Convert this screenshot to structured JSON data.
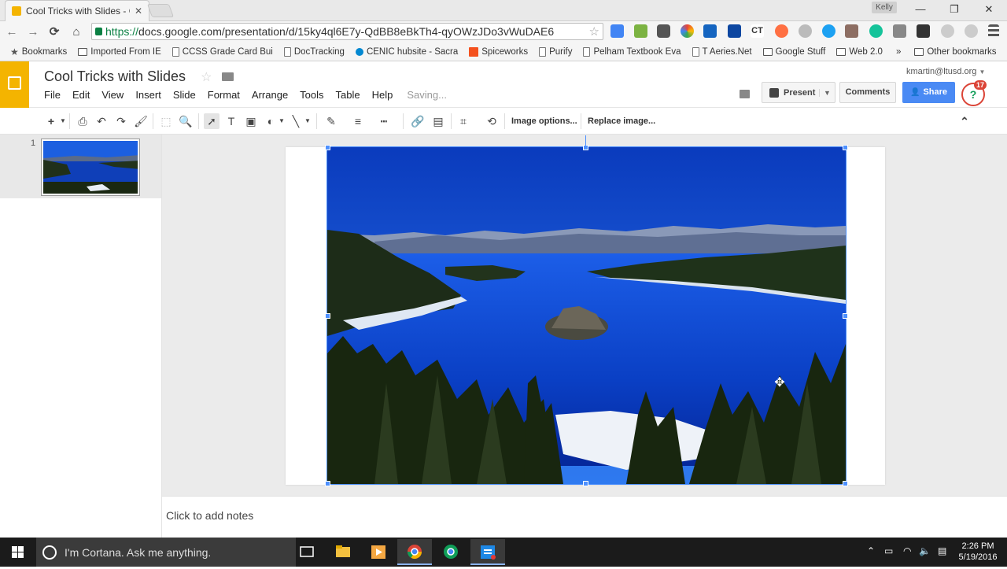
{
  "browser": {
    "tab_title": "Cool Tricks with Slides - G",
    "tab_close": "✕",
    "user_badge": "Kelly",
    "win_minimize": "—",
    "win_restore": "❐",
    "win_close": "✕",
    "url_scheme": "https://",
    "url_rest": "docs.google.com/presentation/d/15ky4ql6E7y-QdBB8eBkTh4-qyOWzJDo3vWuDAE6",
    "back_icon": "←",
    "forward_icon": "→",
    "reload_icon": "⟳",
    "home_icon": "⌂",
    "star_icon": "☆"
  },
  "bookmarks": {
    "items": [
      {
        "label": "Bookmarks",
        "icon": "star-icon"
      },
      {
        "label": "Imported From IE",
        "icon": "folder-icon"
      },
      {
        "label": "CCSS Grade Card Bui",
        "icon": "page-icon"
      },
      {
        "label": "DocTracking",
        "icon": "page-icon"
      },
      {
        "label": "CENIC hubsite - Sacra",
        "icon": "cenic-icon"
      },
      {
        "label": "Spiceworks",
        "icon": "spiceworks-icon"
      },
      {
        "label": "Purify",
        "icon": "page-icon"
      },
      {
        "label": "Pelham Textbook Eva",
        "icon": "page-icon"
      },
      {
        "label": "T Aeries.Net",
        "icon": "page-icon"
      },
      {
        "label": "Google Stuff",
        "icon": "folder-icon"
      },
      {
        "label": "Web 2.0",
        "icon": "folder-icon"
      }
    ],
    "overflow": "»",
    "other_label": "Other bookmarks"
  },
  "docs": {
    "title": "Cool Tricks with Slides",
    "menu": [
      "File",
      "Edit",
      "View",
      "Insert",
      "Slide",
      "Format",
      "Arrange",
      "Tools",
      "Table",
      "Help"
    ],
    "status": "Saving...",
    "email": "kmartin@ltusd.org",
    "present_label": "Present",
    "comments_label": "Comments",
    "share_label": "Share",
    "notification_count": "17",
    "notification_glyph": "?"
  },
  "edit_toolbar": {
    "image_options_label": "Image options...",
    "replace_image_label": "Replace image...",
    "collapse_icon": "⌃"
  },
  "slides": {
    "current_number": "1",
    "notes_placeholder": "Click to add notes"
  },
  "taskbar": {
    "cortana_placeholder": "I'm Cortana. Ask me anything.",
    "time": "2:26 PM",
    "date": "5/19/2016"
  },
  "colors": {
    "slides_brand": "#f4b400",
    "share_blue": "#4a8af4",
    "selection_blue": "#4d90fe",
    "secure_green": "#0b8043"
  }
}
